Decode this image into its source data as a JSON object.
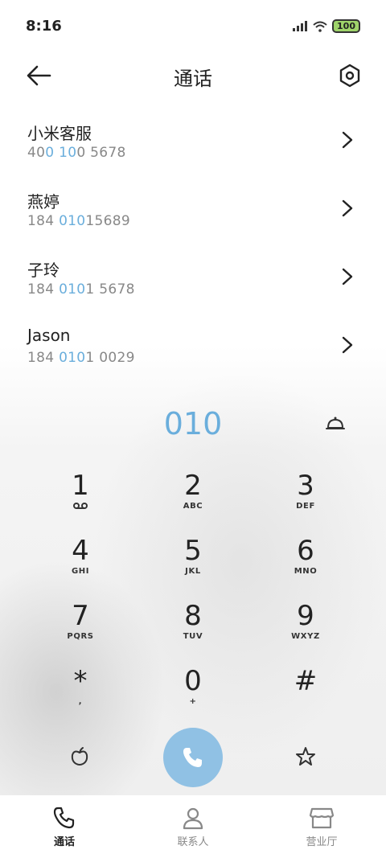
{
  "status_bar": {
    "time": "8:16",
    "battery": "100"
  },
  "header": {
    "title": "通话"
  },
  "contacts": [
    {
      "name": "小米客服",
      "num_parts": [
        "40",
        "0",
        " ",
        "10",
        "0 5678"
      ]
    },
    {
      "name": "燕婷",
      "num_parts": [
        "184 ",
        "010",
        "15689",
        "",
        ""
      ]
    },
    {
      "name": "子玲",
      "num_parts": [
        "184 ",
        "010",
        "1 5678",
        "",
        ""
      ]
    },
    {
      "name": "Jason",
      "num_parts": [
        "184 ",
        "010",
        "1 0029",
        "",
        ""
      ]
    }
  ],
  "dialer": {
    "input_value": "010",
    "keys": [
      {
        "digit": "1",
        "letters": ""
      },
      {
        "digit": "2",
        "letters": "ABC"
      },
      {
        "digit": "3",
        "letters": "DEF"
      },
      {
        "digit": "4",
        "letters": "GHI"
      },
      {
        "digit": "5",
        "letters": "JKL"
      },
      {
        "digit": "6",
        "letters": "MNO"
      },
      {
        "digit": "7",
        "letters": "PQRS"
      },
      {
        "digit": "8",
        "letters": "TUV"
      },
      {
        "digit": "9",
        "letters": "WXYZ"
      },
      {
        "digit": "*",
        "letters": ","
      },
      {
        "digit": "0",
        "letters": "+"
      },
      {
        "digit": "#",
        "letters": ""
      }
    ]
  },
  "bottom_nav": [
    {
      "label": "通话",
      "icon": "phone-icon",
      "active": true
    },
    {
      "label": "联系人",
      "icon": "person-icon",
      "active": false
    },
    {
      "label": "营业厅",
      "icon": "store-icon",
      "active": false
    }
  ],
  "colors": {
    "accent": "#6aaedc",
    "call_button": "#90c1e4",
    "battery": "#9fd46a"
  }
}
